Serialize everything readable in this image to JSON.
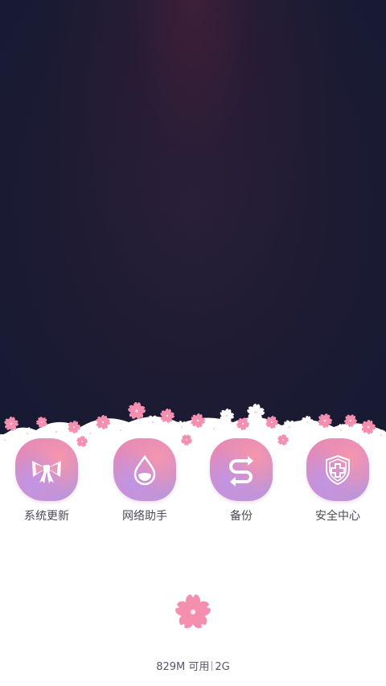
{
  "colors": {
    "sky_top": "#3e1f36",
    "sky_main": "#1e1b33",
    "petal_pink": "#f48fb0",
    "icon_gradient_pink": "#e98ab0",
    "icon_gradient_violet": "#b49ae0",
    "label_text": "#4a4a55"
  },
  "shortcuts": [
    {
      "label": "系统更新",
      "icon": "bow-icon"
    },
    {
      "label": "网络助手",
      "icon": "water-drop-icon"
    },
    {
      "label": "备份",
      "icon": "sync-arrows-icon"
    },
    {
      "label": "安全中心",
      "icon": "shield-plus-icon"
    }
  ],
  "footer": {
    "icon": "sakura-flower-icon",
    "memory_available": "829M 可用",
    "memory_total": "2G"
  }
}
